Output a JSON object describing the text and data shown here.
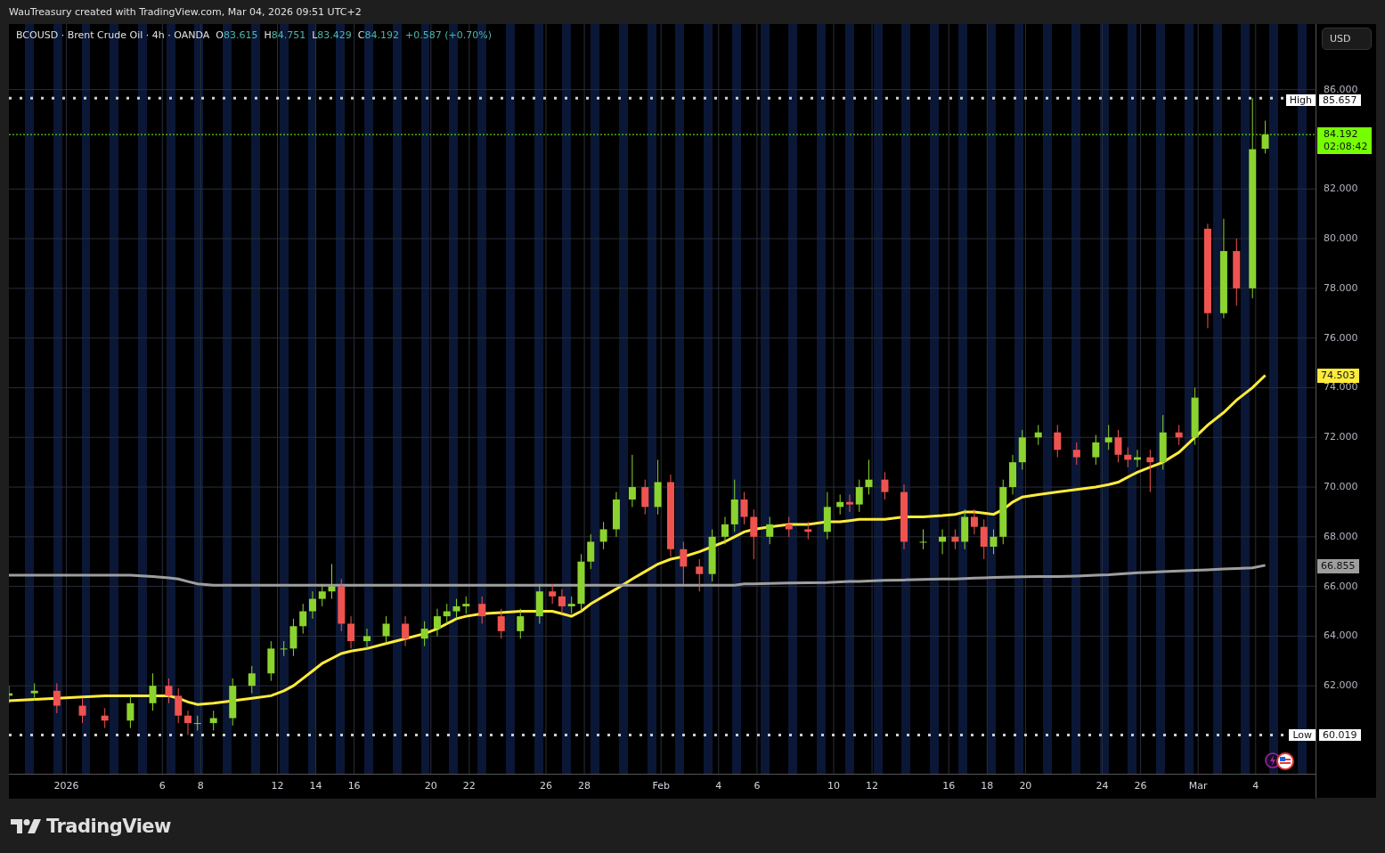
{
  "header": {
    "text": "WauTreasury created with TradingView.com, Mar 04, 2026 09:51 UTC+2"
  },
  "legend": {
    "symbol": "BCOUSD · Brent Crude Oil · 4h · OANDA",
    "ohlc": [
      {
        "label": "O",
        "value": "83.615"
      },
      {
        "label": "H",
        "value": "84.751"
      },
      {
        "label": "L",
        "value": "83.429"
      },
      {
        "label": "C",
        "value": "84.192"
      }
    ],
    "change": "+0.587 (+0.70%)"
  },
  "currency_button": "USD",
  "levels": [
    {
      "label": "High",
      "value": "85.657"
    },
    {
      "label": "Low",
      "value": "60.019"
    }
  ],
  "price_tags": [
    {
      "kind": "last",
      "value": "84.192",
      "countdown": "02:08:42",
      "color": "#76ff03"
    },
    {
      "kind": "ma",
      "value": "74.503",
      "color": "#ffeb3b"
    },
    {
      "kind": "ma",
      "value": "66.855",
      "color": "#9e9e9e"
    }
  ],
  "chart_data": {
    "type": "candlestick",
    "grid": true,
    "x": [
      "2025-12-29T00:00",
      "2025-12-30T08:00",
      "2025-12-31T12:00",
      "2026-01-01T20:00",
      "2026-01-03T00:00",
      "2026-01-04T08:00",
      "2026-01-05T12:00",
      "2026-01-06T08:00",
      "2026-01-06T20:00",
      "2026-01-07T08:00",
      "2026-01-07T20:00",
      "2026-01-08T16:00",
      "2026-01-09T16:00",
      "2026-01-10T16:00",
      "2026-01-11T16:00",
      "2026-01-12T08:00",
      "2026-01-12T20:00",
      "2026-01-13T08:00",
      "2026-01-13T20:00",
      "2026-01-14T08:00",
      "2026-01-14T20:00",
      "2026-01-15T08:00",
      "2026-01-15T20:00",
      "2026-01-16T16:00",
      "2026-01-17T16:00",
      "2026-01-18T16:00",
      "2026-01-19T16:00",
      "2026-01-20T08:00",
      "2026-01-20T20:00",
      "2026-01-21T08:00",
      "2026-01-21T20:00",
      "2026-01-22T16:00",
      "2026-01-23T16:00",
      "2026-01-24T16:00",
      "2026-01-25T16:00",
      "2026-01-26T08:00",
      "2026-01-26T20:00",
      "2026-01-27T08:00",
      "2026-01-27T20:00",
      "2026-01-28T08:00",
      "2026-01-29T00:00",
      "2026-01-29T16:00",
      "2026-01-30T12:00",
      "2026-01-31T04:00",
      "2026-01-31T20:00",
      "2026-02-01T12:00",
      "2026-02-02T04:00",
      "2026-02-03T00:00",
      "2026-02-03T16:00",
      "2026-02-04T08:00",
      "2026-02-04T20:00",
      "2026-02-05T08:00",
      "2026-02-05T20:00",
      "2026-02-06T16:00",
      "2026-02-07T16:00",
      "2026-02-08T16:00",
      "2026-02-09T16:00",
      "2026-02-10T08:00",
      "2026-02-10T20:00",
      "2026-02-11T08:00",
      "2026-02-11T20:00",
      "2026-02-12T16:00",
      "2026-02-13T16:00",
      "2026-02-14T16:00",
      "2026-02-15T16:00",
      "2026-02-16T08:00",
      "2026-02-16T20:00",
      "2026-02-17T08:00",
      "2026-02-17T20:00",
      "2026-02-18T08:00",
      "2026-02-18T20:00",
      "2026-02-19T08:00",
      "2026-02-19T20:00",
      "2026-02-20T16:00",
      "2026-02-21T16:00",
      "2026-02-22T16:00",
      "2026-02-23T16:00",
      "2026-02-24T08:00",
      "2026-02-24T20:00",
      "2026-02-25T08:00",
      "2026-02-25T20:00",
      "2026-02-26T12:00",
      "2026-02-27T04:00",
      "2026-02-28T00:00",
      "2026-02-28T20:00",
      "2026-03-01T12:00",
      "2026-03-02T08:00",
      "2026-03-03T00:00",
      "2026-03-03T20:00",
      "2026-03-04T12:00"
    ],
    "xlim": [
      "2025-12-29T00:00",
      "2026-03-07T04:00"
    ],
    "ylim": [
      58.46,
      88.64
    ],
    "xticks": [
      {
        "value": "2026-01-01T00:00",
        "label": "2026"
      },
      {
        "value": "2026-01-06T00:00",
        "label": "6"
      },
      {
        "value": "2026-01-08T00:00",
        "label": "8"
      },
      {
        "value": "2026-01-12T00:00",
        "label": "12"
      },
      {
        "value": "2026-01-14T00:00",
        "label": "14"
      },
      {
        "value": "2026-01-16T00:00",
        "label": "16"
      },
      {
        "value": "2026-01-20T00:00",
        "label": "20"
      },
      {
        "value": "2026-01-22T00:00",
        "label": "22"
      },
      {
        "value": "2026-01-26T00:00",
        "label": "26"
      },
      {
        "value": "2026-01-28T00:00",
        "label": "28"
      },
      {
        "value": "2026-02-01T00:00",
        "label": "Feb"
      },
      {
        "value": "2026-02-04T00:00",
        "label": "4"
      },
      {
        "value": "2026-02-06T00:00",
        "label": "6"
      },
      {
        "value": "2026-02-10T00:00",
        "label": "10"
      },
      {
        "value": "2026-02-12T00:00",
        "label": "12"
      },
      {
        "value": "2026-02-16T00:00",
        "label": "16"
      },
      {
        "value": "2026-02-18T00:00",
        "label": "18"
      },
      {
        "value": "2026-02-20T00:00",
        "label": "20"
      },
      {
        "value": "2026-02-24T00:00",
        "label": "24"
      },
      {
        "value": "2026-02-26T00:00",
        "label": "26"
      },
      {
        "value": "2026-03-01T00:00",
        "label": "Mar"
      },
      {
        "value": "2026-03-04T00:00",
        "label": "4"
      }
    ],
    "yticks": [
      {
        "value": 62,
        "label": "62.000"
      },
      {
        "value": 64,
        "label": "64.000"
      },
      {
        "value": 66,
        "label": "66.000"
      },
      {
        "value": 68,
        "label": "68.000"
      },
      {
        "value": 70,
        "label": "70.000"
      },
      {
        "value": 72,
        "label": "72.000"
      },
      {
        "value": 74,
        "label": "74.000"
      },
      {
        "value": 76,
        "label": "76.000"
      },
      {
        "value": 78,
        "label": "78.000"
      },
      {
        "value": 80,
        "label": "80.000"
      },
      {
        "value": 82,
        "label": "82.000"
      },
      {
        "value": 86,
        "label": "86.000"
      }
    ],
    "ohlc": [
      [
        61.6,
        62.0,
        61.3,
        61.7
      ],
      [
        61.7,
        62.1,
        61.4,
        61.8
      ],
      [
        61.8,
        62.1,
        60.9,
        61.2
      ],
      [
        61.2,
        61.5,
        60.5,
        60.8
      ],
      [
        60.8,
        61.1,
        60.3,
        60.6
      ],
      [
        60.6,
        61.6,
        60.3,
        61.3
      ],
      [
        61.3,
        62.5,
        61.0,
        62.0
      ],
      [
        62.0,
        62.3,
        61.3,
        61.6
      ],
      [
        61.6,
        61.9,
        60.5,
        60.8
      ],
      [
        60.8,
        61.0,
        60.02,
        60.5
      ],
      [
        60.5,
        60.8,
        60.2,
        60.5
      ],
      [
        60.5,
        61.0,
        60.2,
        60.7
      ],
      [
        60.7,
        62.3,
        60.4,
        62.0
      ],
      [
        62.0,
        62.8,
        61.7,
        62.5
      ],
      [
        62.5,
        63.8,
        62.2,
        63.5
      ],
      [
        63.5,
        63.8,
        63.2,
        63.5
      ],
      [
        63.5,
        64.7,
        63.2,
        64.4
      ],
      [
        64.4,
        65.3,
        64.1,
        65.0
      ],
      [
        65.0,
        65.8,
        64.7,
        65.5
      ],
      [
        65.5,
        66.1,
        65.2,
        65.8
      ],
      [
        65.8,
        66.9,
        65.5,
        66.0
      ],
      [
        66.0,
        66.3,
        64.2,
        64.5
      ],
      [
        64.5,
        64.8,
        63.5,
        63.8
      ],
      [
        63.8,
        64.3,
        63.5,
        64.0
      ],
      [
        64.0,
        64.8,
        63.7,
        64.5
      ],
      [
        64.5,
        64.8,
        63.6,
        63.9
      ],
      [
        63.9,
        64.6,
        63.6,
        64.3
      ],
      [
        64.3,
        65.1,
        64.0,
        64.8
      ],
      [
        64.8,
        65.3,
        64.5,
        65.0
      ],
      [
        65.0,
        65.5,
        64.7,
        65.2
      ],
      [
        65.2,
        65.6,
        64.9,
        65.3
      ],
      [
        65.3,
        65.6,
        64.5,
        64.8
      ],
      [
        64.8,
        65.1,
        63.9,
        64.2
      ],
      [
        64.2,
        65.1,
        63.9,
        64.8
      ],
      [
        64.8,
        66.1,
        64.5,
        65.8
      ],
      [
        65.8,
        66.1,
        65.3,
        65.6
      ],
      [
        65.6,
        65.9,
        64.9,
        65.2
      ],
      [
        65.2,
        65.6,
        64.9,
        65.3
      ],
      [
        65.3,
        67.3,
        65.0,
        67.0
      ],
      [
        67.0,
        68.1,
        66.7,
        67.8
      ],
      [
        67.8,
        68.6,
        67.5,
        68.3
      ],
      [
        68.3,
        69.8,
        68.0,
        69.5
      ],
      [
        69.5,
        71.3,
        69.2,
        70.0
      ],
      [
        70.0,
        70.3,
        68.9,
        69.2
      ],
      [
        69.2,
        71.1,
        68.9,
        70.2
      ],
      [
        70.2,
        70.5,
        67.2,
        67.5
      ],
      [
        67.5,
        67.8,
        66.1,
        66.8
      ],
      [
        66.8,
        67.1,
        65.8,
        66.5
      ],
      [
        66.5,
        68.3,
        66.2,
        68.0
      ],
      [
        68.0,
        68.8,
        67.7,
        68.5
      ],
      [
        68.5,
        70.3,
        68.2,
        69.5
      ],
      [
        69.5,
        69.8,
        68.5,
        68.8
      ],
      [
        68.8,
        69.1,
        67.1,
        68.0
      ],
      [
        68.0,
        68.8,
        67.7,
        68.5
      ],
      [
        68.5,
        68.8,
        68.0,
        68.3
      ],
      [
        68.3,
        68.6,
        67.9,
        68.2
      ],
      [
        68.2,
        69.8,
        67.9,
        69.2
      ],
      [
        69.2,
        69.7,
        68.9,
        69.4
      ],
      [
        69.4,
        69.7,
        69.0,
        69.3
      ],
      [
        69.3,
        70.3,
        69.0,
        70.0
      ],
      [
        70.0,
        71.1,
        69.7,
        70.3
      ],
      [
        70.3,
        70.6,
        69.5,
        69.8
      ],
      [
        69.8,
        70.1,
        67.5,
        67.8
      ],
      [
        67.8,
        68.3,
        67.5,
        67.8
      ],
      [
        67.8,
        68.3,
        67.3,
        68.0
      ],
      [
        68.0,
        68.3,
        67.5,
        67.8
      ],
      [
        67.8,
        69.1,
        67.5,
        68.8
      ],
      [
        68.8,
        69.1,
        68.1,
        68.4
      ],
      [
        68.4,
        68.7,
        67.1,
        67.6
      ],
      [
        67.6,
        68.3,
        67.3,
        68.0
      ],
      [
        68.0,
        70.3,
        67.7,
        70.0
      ],
      [
        70.0,
        71.3,
        69.7,
        71.0
      ],
      [
        71.0,
        72.3,
        70.7,
        72.0
      ],
      [
        72.0,
        72.5,
        71.7,
        72.2
      ],
      [
        72.2,
        72.5,
        71.2,
        71.5
      ],
      [
        71.5,
        71.8,
        70.9,
        71.2
      ],
      [
        71.2,
        72.1,
        70.9,
        71.8
      ],
      [
        71.8,
        72.5,
        71.5,
        72.0
      ],
      [
        72.0,
        72.3,
        71.0,
        71.3
      ],
      [
        71.3,
        71.6,
        70.8,
        71.1
      ],
      [
        71.1,
        71.5,
        70.8,
        71.2
      ],
      [
        71.2,
        71.5,
        69.8,
        71.0
      ],
      [
        71.0,
        72.9,
        70.7,
        72.2
      ],
      [
        72.2,
        72.5,
        71.7,
        72.0
      ],
      [
        72.0,
        74.0,
        71.7,
        73.6
      ],
      [
        80.4,
        80.6,
        76.4,
        77.0
      ],
      [
        77.0,
        80.8,
        76.8,
        79.5
      ],
      [
        79.5,
        80.0,
        77.3,
        78.0
      ],
      [
        78.0,
        85.66,
        77.6,
        83.6
      ],
      [
        83.62,
        84.75,
        83.43,
        84.19
      ]
    ],
    "ref_lines": [
      {
        "axis": "y",
        "value": 85.657,
        "color": "#cfcfcf"
      },
      {
        "axis": "y",
        "value": 60.019,
        "color": "#cfcfcf"
      },
      {
        "axis": "y",
        "value": 84.192,
        "color": "#76ff03"
      }
    ],
    "series": [
      {
        "type": "line",
        "color": "#ffeb3b",
        "values": [
          61.4,
          61.45,
          61.5,
          61.55,
          61.6,
          61.6,
          61.6,
          61.6,
          61.5,
          61.35,
          61.25,
          61.3,
          61.4,
          61.5,
          61.6,
          61.8,
          62.0,
          62.3,
          62.6,
          62.9,
          63.1,
          63.3,
          63.4,
          63.5,
          63.7,
          63.9,
          64.1,
          64.3,
          64.5,
          64.7,
          64.8,
          64.9,
          64.95,
          65.0,
          65.0,
          65.0,
          64.9,
          64.8,
          65.0,
          65.3,
          65.6,
          65.9,
          66.3,
          66.6,
          66.9,
          67.1,
          67.2,
          67.4,
          67.6,
          67.8,
          68.0,
          68.2,
          68.3,
          68.4,
          68.5,
          68.5,
          68.6,
          68.6,
          68.65,
          68.7,
          68.7,
          68.7,
          68.8,
          68.8,
          68.85,
          68.9,
          69.0,
          69.0,
          68.95,
          68.9,
          69.1,
          69.4,
          69.6,
          69.7,
          69.8,
          69.9,
          70.0,
          70.1,
          70.2,
          70.4,
          70.6,
          70.8,
          71.0,
          71.4,
          72.0,
          72.5,
          73.0,
          73.5,
          74.0,
          74.5
        ]
      },
      {
        "type": "line",
        "color": "#9e9e9e",
        "values": [
          66.45,
          66.45,
          66.45,
          66.45,
          66.45,
          66.45,
          66.4,
          66.35,
          66.3,
          66.2,
          66.1,
          66.05,
          66.05,
          66.05,
          66.05,
          66.05,
          66.05,
          66.05,
          66.05,
          66.05,
          66.05,
          66.05,
          66.05,
          66.05,
          66.05,
          66.05,
          66.05,
          66.05,
          66.05,
          66.05,
          66.05,
          66.05,
          66.05,
          66.05,
          66.05,
          66.05,
          66.05,
          66.05,
          66.05,
          66.05,
          66.05,
          66.05,
          66.05,
          66.05,
          66.05,
          66.05,
          66.05,
          66.05,
          66.05,
          66.05,
          66.05,
          66.1,
          66.1,
          66.12,
          66.14,
          66.15,
          66.16,
          66.18,
          66.2,
          66.2,
          66.22,
          66.25,
          66.26,
          66.28,
          66.3,
          66.3,
          66.32,
          66.34,
          66.35,
          66.36,
          66.37,
          66.38,
          66.39,
          66.4,
          66.4,
          66.42,
          66.45,
          66.47,
          66.5,
          66.52,
          66.55,
          66.57,
          66.6,
          66.62,
          66.65,
          66.67,
          66.7,
          66.72,
          66.75,
          66.85
        ]
      }
    ]
  },
  "footer": {
    "logo": "TradingView"
  }
}
